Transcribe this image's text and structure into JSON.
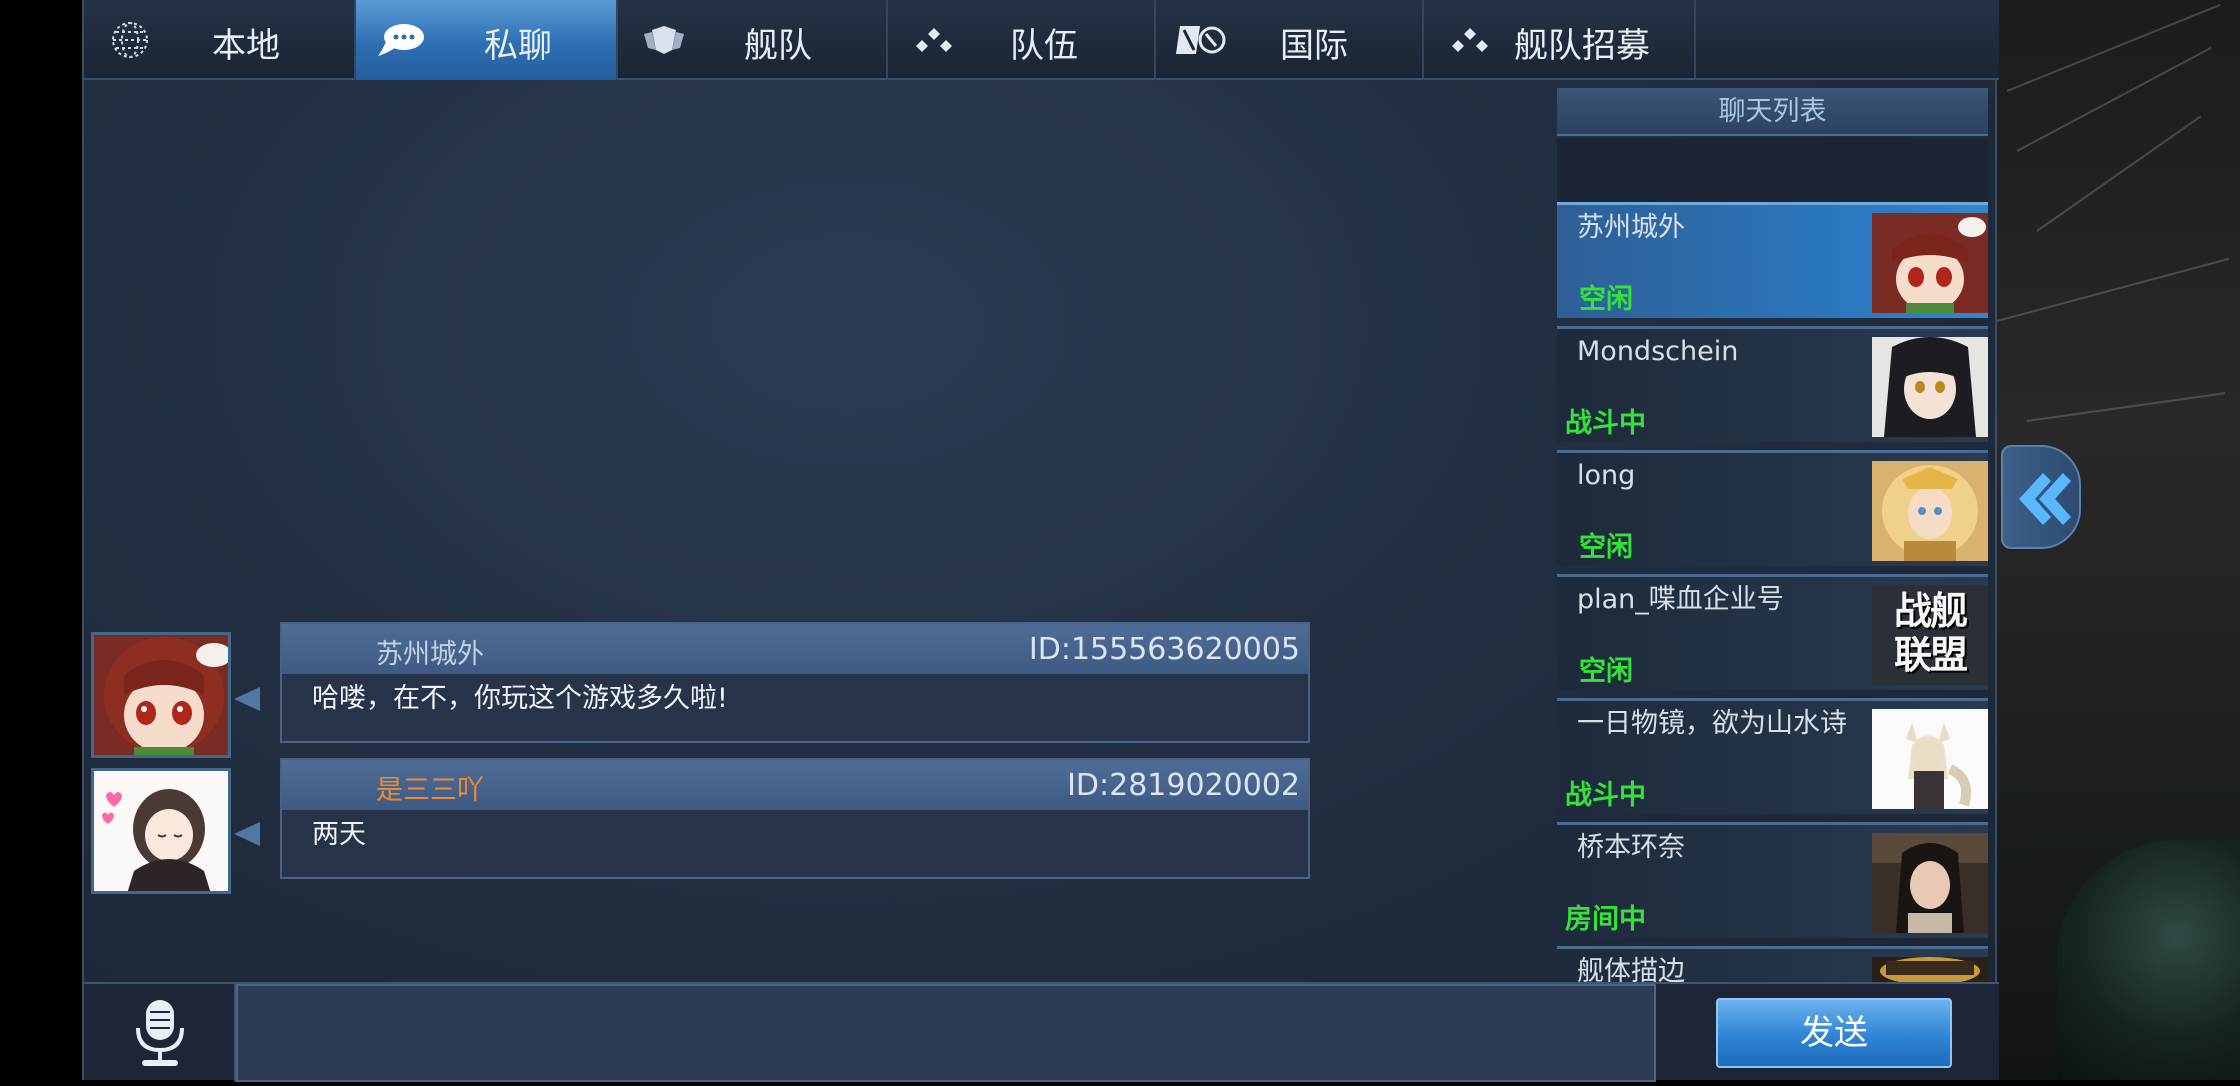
{
  "tabs": [
    {
      "label": "本地",
      "icon": "globe-icon"
    },
    {
      "label": "私聊",
      "icon": "chat-bubble-icon"
    },
    {
      "label": "舰队",
      "icon": "fleet-emblem-icon"
    },
    {
      "label": "队伍",
      "icon": "team-dots-icon"
    },
    {
      "label": "国际",
      "icon": "flag-icon"
    },
    {
      "label": "舰队招募",
      "icon": "recruit-dots-icon"
    }
  ],
  "active_tab": "私聊",
  "messages": [
    {
      "name": "苏州城外",
      "id": "ID:155563620005",
      "text": "哈喽，在不，你玩这个游戏多久啦!",
      "name_color": "#c2d2e6"
    },
    {
      "name": "是三三吖",
      "id": "ID:2819020002",
      "text": "两天",
      "name_color": "#f08a2c"
    }
  ],
  "chat_list": {
    "title": "聊天列表",
    "contacts": [
      {
        "name": "苏州城外",
        "status": "空闲",
        "status_color": "#35e23a"
      },
      {
        "name": "Mondschein",
        "status": "战斗中",
        "status_color": "#35e23a"
      },
      {
        "name": "long",
        "status": "空闲",
        "status_color": "#35e23a"
      },
      {
        "name": "plan_喋血企业号",
        "status": "空闲",
        "status_color": "#35e23a",
        "badge_text": "战舰联盟"
      },
      {
        "name": "一日物镜，欲为山水诗",
        "status": "战斗中",
        "status_color": "#35e23a"
      },
      {
        "name": "桥本环奈",
        "status": "房间中",
        "status_color": "#35e23a"
      },
      {
        "name": "舰体描边",
        "status": "",
        "status_color": "#35e23a"
      }
    ]
  },
  "input": {
    "value": "",
    "placeholder": ""
  },
  "send_label": "发送"
}
